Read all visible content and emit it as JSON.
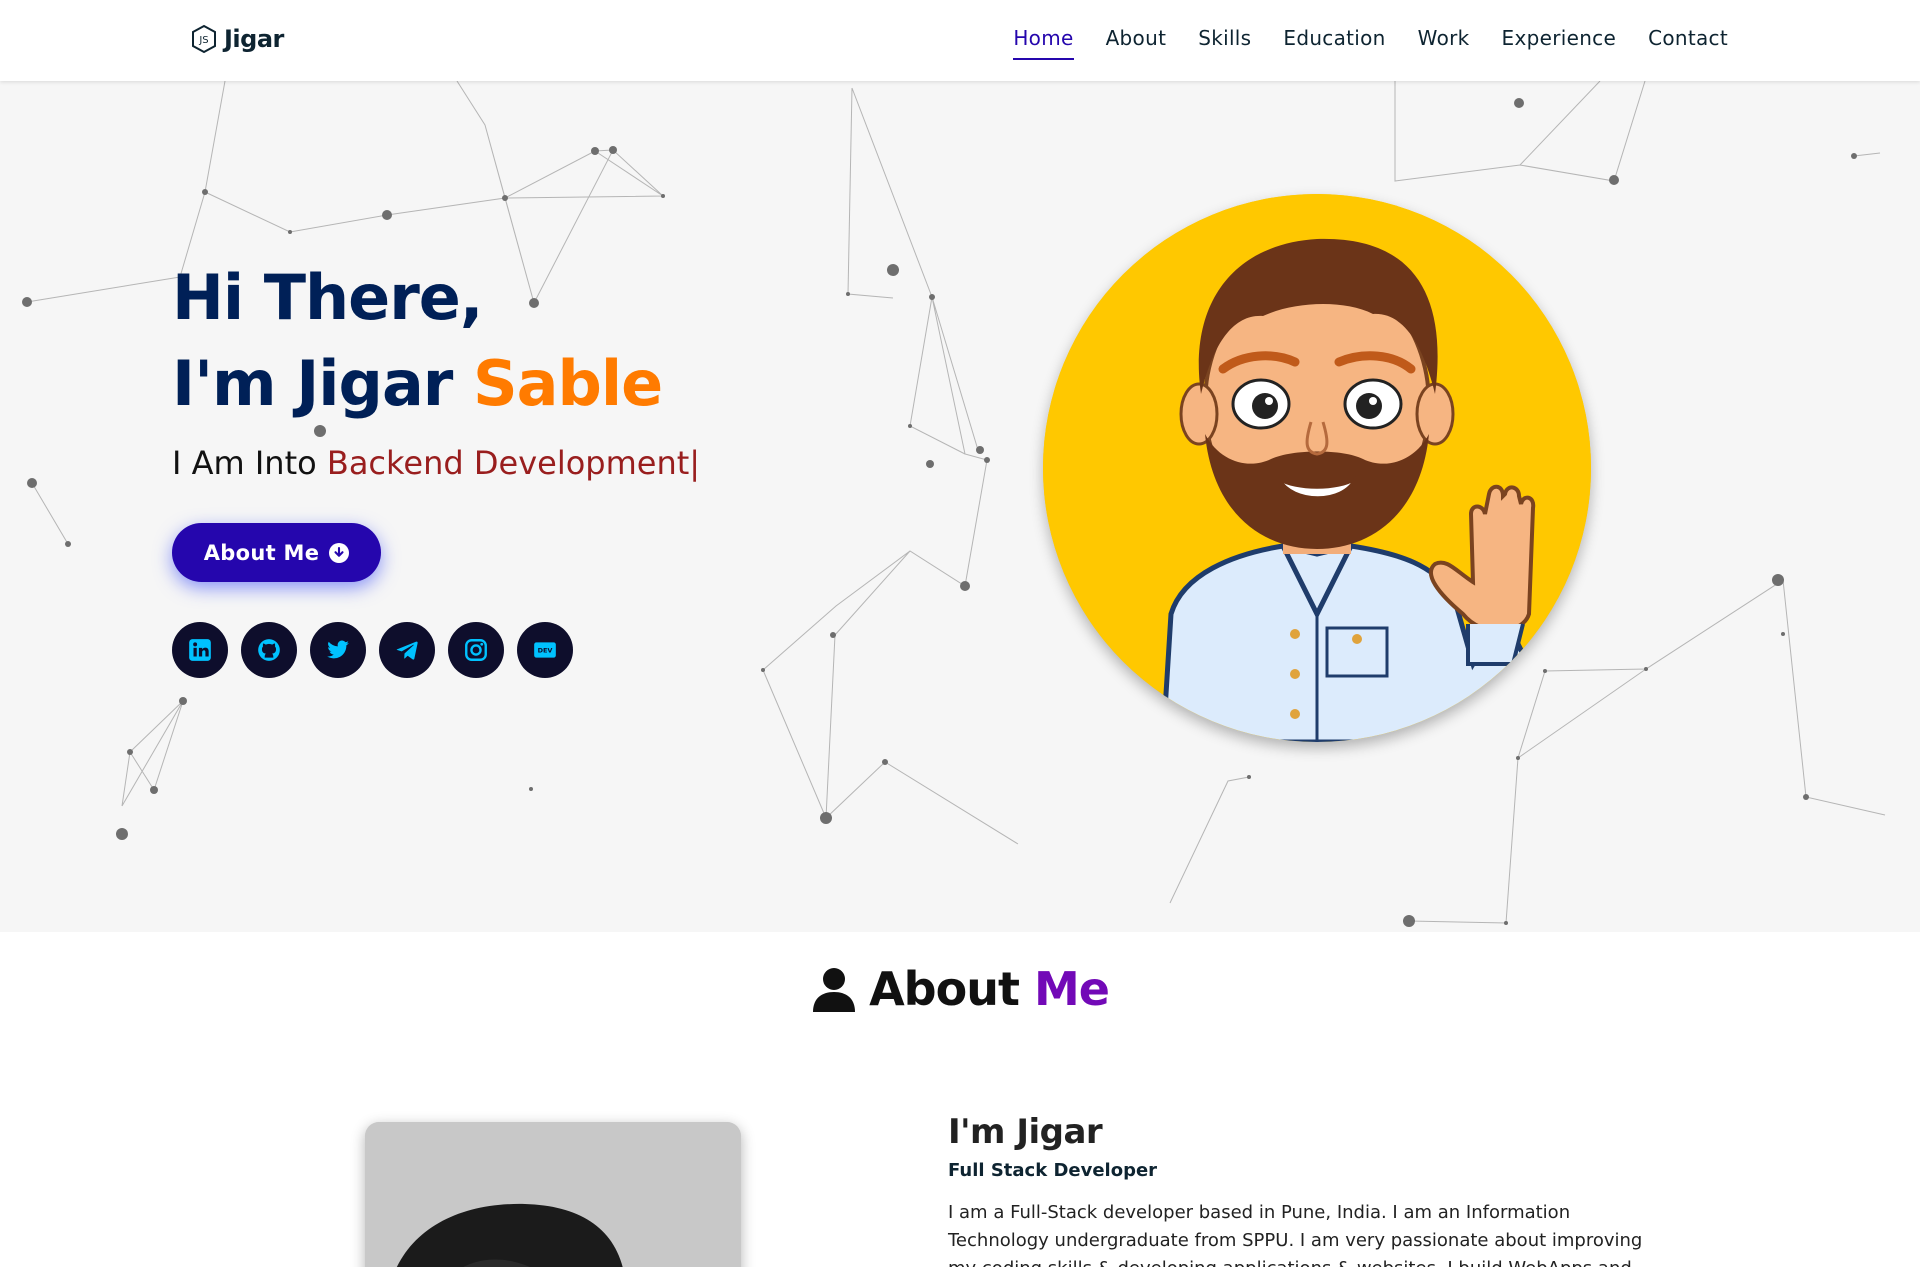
{
  "nav": {
    "brand": "Jigar",
    "links": [
      "Home",
      "About",
      "Skills",
      "Education",
      "Work",
      "Experience",
      "Contact"
    ],
    "active": "Home"
  },
  "hero": {
    "greeting": "Hi There,",
    "name_prefix": "I'm Jigar ",
    "name_accent": "Sable",
    "into_prefix": "I Am Into ",
    "into_typed": "Backend Development|",
    "button_label": "About Me",
    "socials": [
      "linkedin-icon",
      "github-icon",
      "twitter-icon",
      "telegram-icon",
      "instagram-icon",
      "dev-icon"
    ],
    "colors": {
      "accent": "#ff7b00",
      "primary": "#2506ad",
      "typed": "#991e1e",
      "avatar_bg": "#ffc800"
    }
  },
  "about": {
    "title_prefix": "About ",
    "title_accent": "Me",
    "heading": "I'm Jigar",
    "role": "Full Stack Developer",
    "bio": "I am a Full-Stack developer based in Pune, India. I am an Information Technology undergraduate from SPPU. I am very passionate about improving my coding skills & developing applications & websites. I build WebApps and Websites using MERN"
  }
}
